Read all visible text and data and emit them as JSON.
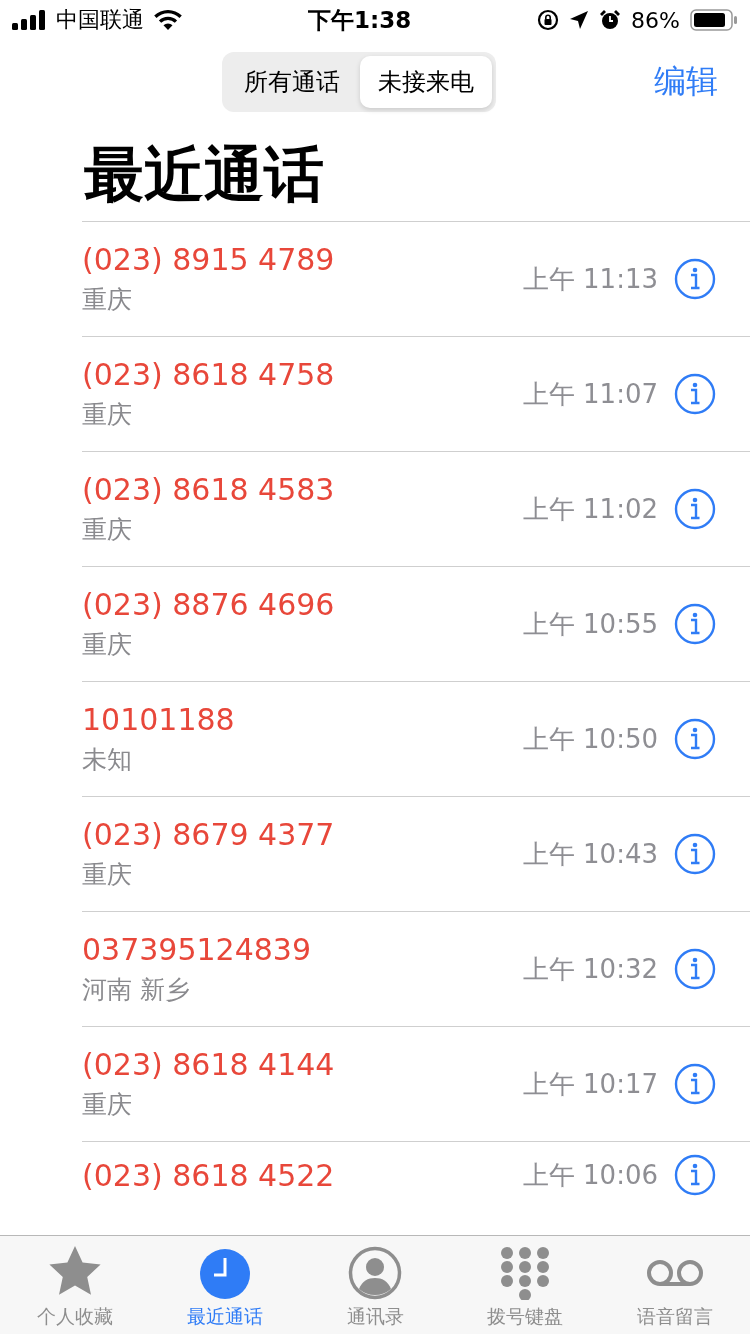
{
  "status_bar": {
    "carrier": "中国联通",
    "time": "下午1:38",
    "battery": "86%"
  },
  "segmented_control": [
    {
      "label": "所有通话",
      "selected": false
    },
    {
      "label": "未接来电",
      "selected": true
    }
  ],
  "edit_button": "编辑",
  "title": "最近通话",
  "calls": [
    {
      "number": "(023) 8915 4789",
      "location": "重庆",
      "time": "上午 11:13",
      "missed": true
    },
    {
      "number": "(023) 8618 4758",
      "location": "重庆",
      "time": "上午 11:07",
      "missed": true
    },
    {
      "number": "(023) 8618 4583",
      "location": "重庆",
      "time": "上午 11:02",
      "missed": true
    },
    {
      "number": "(023) 8876 4696",
      "location": "重庆",
      "time": "上午 10:55",
      "missed": true
    },
    {
      "number": "10101188",
      "location": "未知",
      "time": "上午 10:50",
      "missed": true
    },
    {
      "number": "(023) 8679 4377",
      "location": "重庆",
      "time": "上午 10:43",
      "missed": true
    },
    {
      "number": "037395124839",
      "location": "河南 新乡",
      "time": "上午 10:32",
      "missed": true
    },
    {
      "number": "(023) 8618 4144",
      "location": "重庆",
      "time": "上午 10:17",
      "missed": true
    },
    {
      "number": "(023) 8618 4522",
      "time": "上午 10:06",
      "missed": true
    }
  ],
  "tab_bar": [
    {
      "kind": "star",
      "label": "个人收藏",
      "selected": false
    },
    {
      "kind": "clock",
      "label": "最近通话",
      "selected": true
    },
    {
      "kind": "person",
      "label": "通讯录",
      "selected": false
    },
    {
      "kind": "keypad",
      "label": "拨号键盘",
      "selected": false
    },
    {
      "kind": "voicemail",
      "label": "语音留言",
      "selected": false
    }
  ]
}
